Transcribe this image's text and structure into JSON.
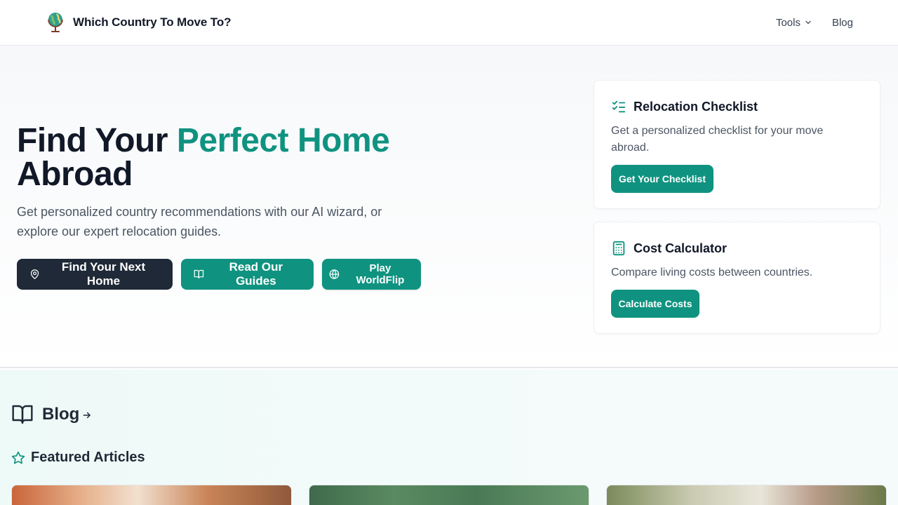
{
  "header": {
    "brand_name": "Which Country To Move To?",
    "nav": {
      "tools_label": "Tools",
      "blog_label": "Blog"
    }
  },
  "hero": {
    "title_plain": "Find Your ",
    "title_accent": "Perfect Home",
    "title_end": "Abroad",
    "subtitle": "Get personalized country recommendations with our AI wizard, or explore our expert relocation guides.",
    "buttons": {
      "find_home": "Find Your Next Home",
      "read_guides": "Read Our Guides",
      "worldflip": "Play WorldFlip"
    }
  },
  "cards": {
    "checklist": {
      "title": "Relocation Checklist",
      "description": "Get a personalized checklist for your move abroad.",
      "button": "Get Your Checklist",
      "icon": "list-checks-icon"
    },
    "calculator": {
      "title": "Cost Calculator",
      "description": "Compare living costs between countries.",
      "button": "Calculate Costs",
      "icon": "calculator-icon"
    }
  },
  "blog": {
    "title": "Blog",
    "featured_title": "Featured Articles"
  },
  "colors": {
    "accent": "#0f9380",
    "dark": "#1f2937"
  }
}
